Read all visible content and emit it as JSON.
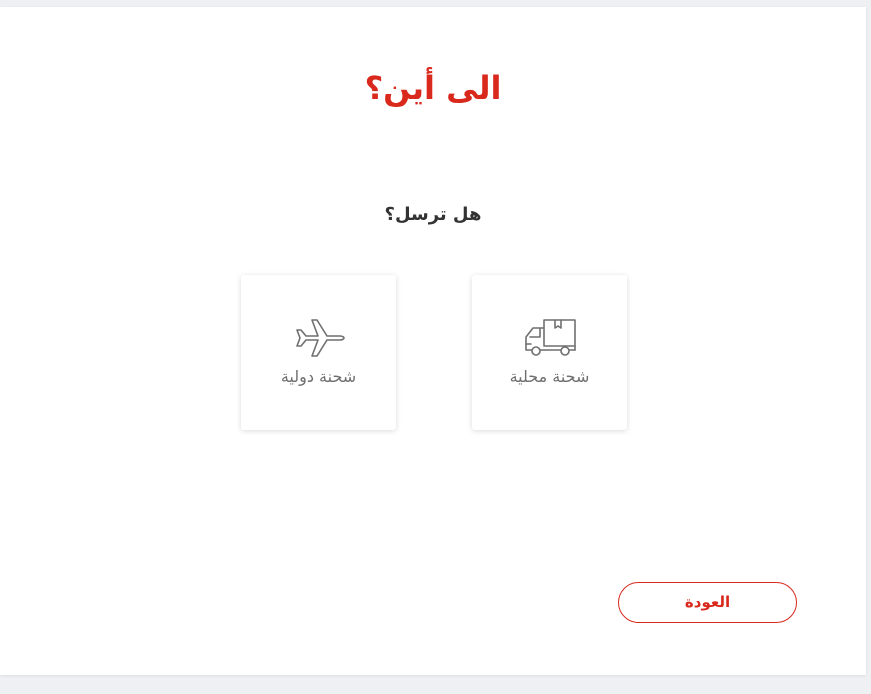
{
  "page": {
    "title": "الى أين؟",
    "question": "هل ترسل؟"
  },
  "options": [
    {
      "label": "شحنة محلية",
      "icon": "delivery-truck-icon"
    },
    {
      "label": "شحنة دولية",
      "icon": "airplane-icon"
    }
  ],
  "actions": {
    "back_label": "العودة"
  },
  "colors": {
    "accent": "#d9281c",
    "text": "#333333",
    "muted": "#6f6f6f",
    "background": "#eef0f4"
  }
}
